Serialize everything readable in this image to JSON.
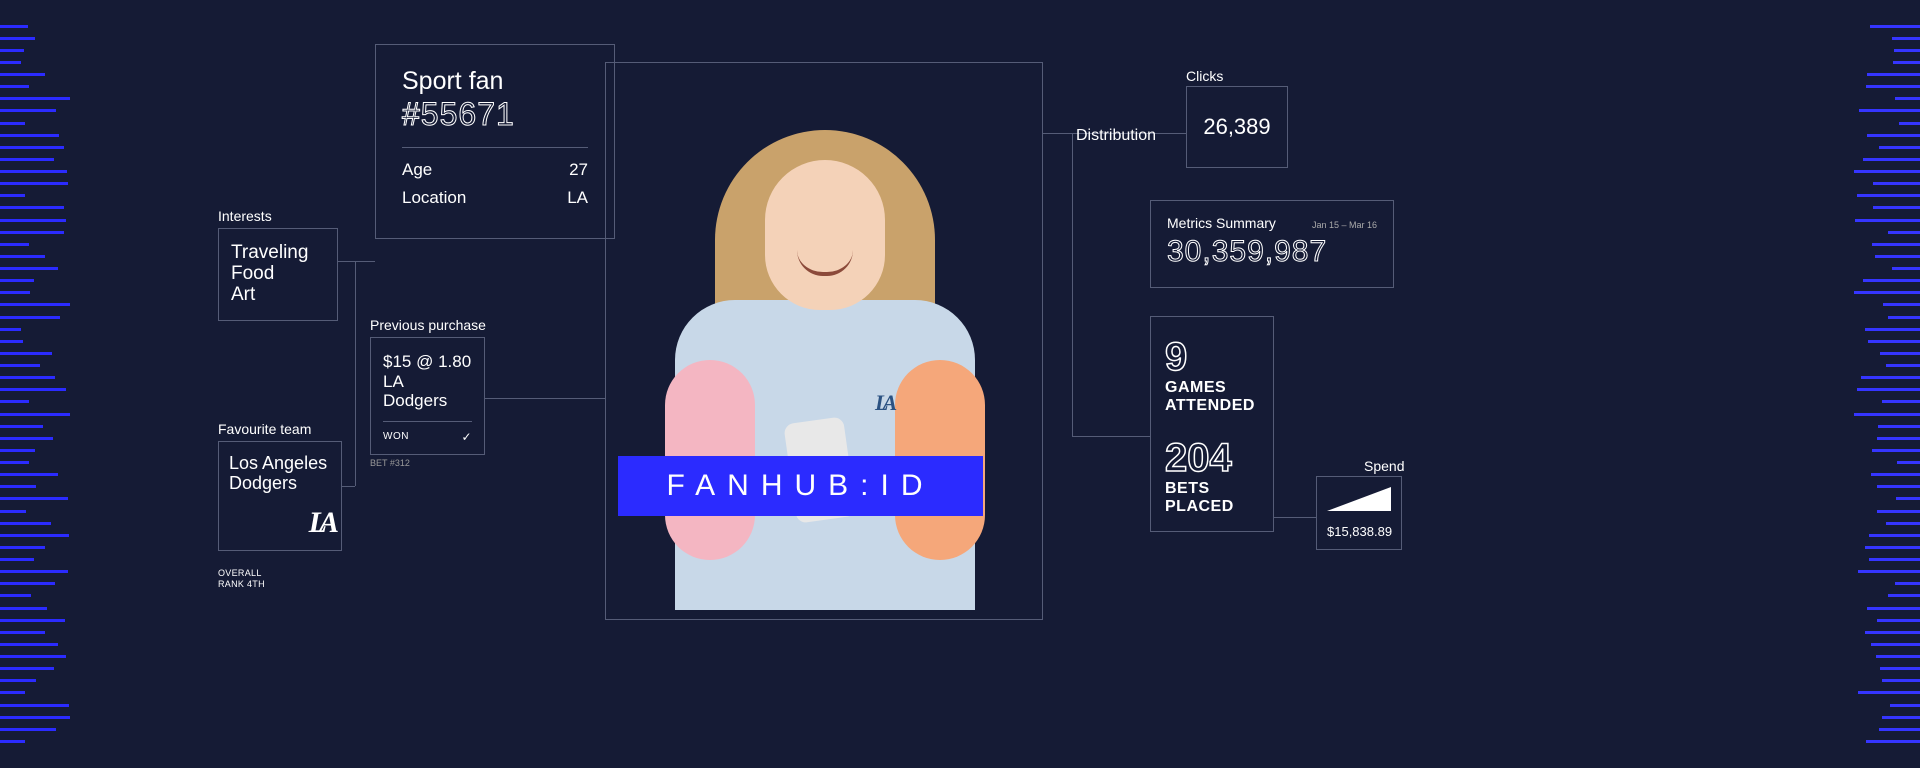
{
  "interests": {
    "label": "Interests",
    "items": [
      "Traveling",
      "Food",
      "Art"
    ]
  },
  "favteam": {
    "label": "Favourite team",
    "name1": "Los Angeles",
    "name2": "Dodgers",
    "logo": "LA",
    "rank1": "OVERALL",
    "rank2": "RANK 4TH"
  },
  "sportfan": {
    "title": "Sport fan",
    "id": "#55671",
    "age_label": "Age",
    "age": "27",
    "loc_label": "Location",
    "loc": "LA"
  },
  "prevpurch": {
    "label": "Previous purchase",
    "line1": "$15 @ 1.80",
    "line2": "LA",
    "line3": "Dodgers",
    "status": "WON",
    "betno": "BET #312"
  },
  "banner": "FANHUB:ID",
  "distribution": "Distribution",
  "clicks": {
    "label": "Clicks",
    "value": "26,389"
  },
  "metrics": {
    "title": "Metrics Summary",
    "date": "Jan 15 – Mar 16",
    "value": "30,359,987"
  },
  "stats": {
    "n1": "9",
    "l1a": "GAMES",
    "l1b": "ATTENDED",
    "n2": "204",
    "l2": "BETS PLACED"
  },
  "spend": {
    "label": "Spend",
    "value": "$15,838.89"
  }
}
